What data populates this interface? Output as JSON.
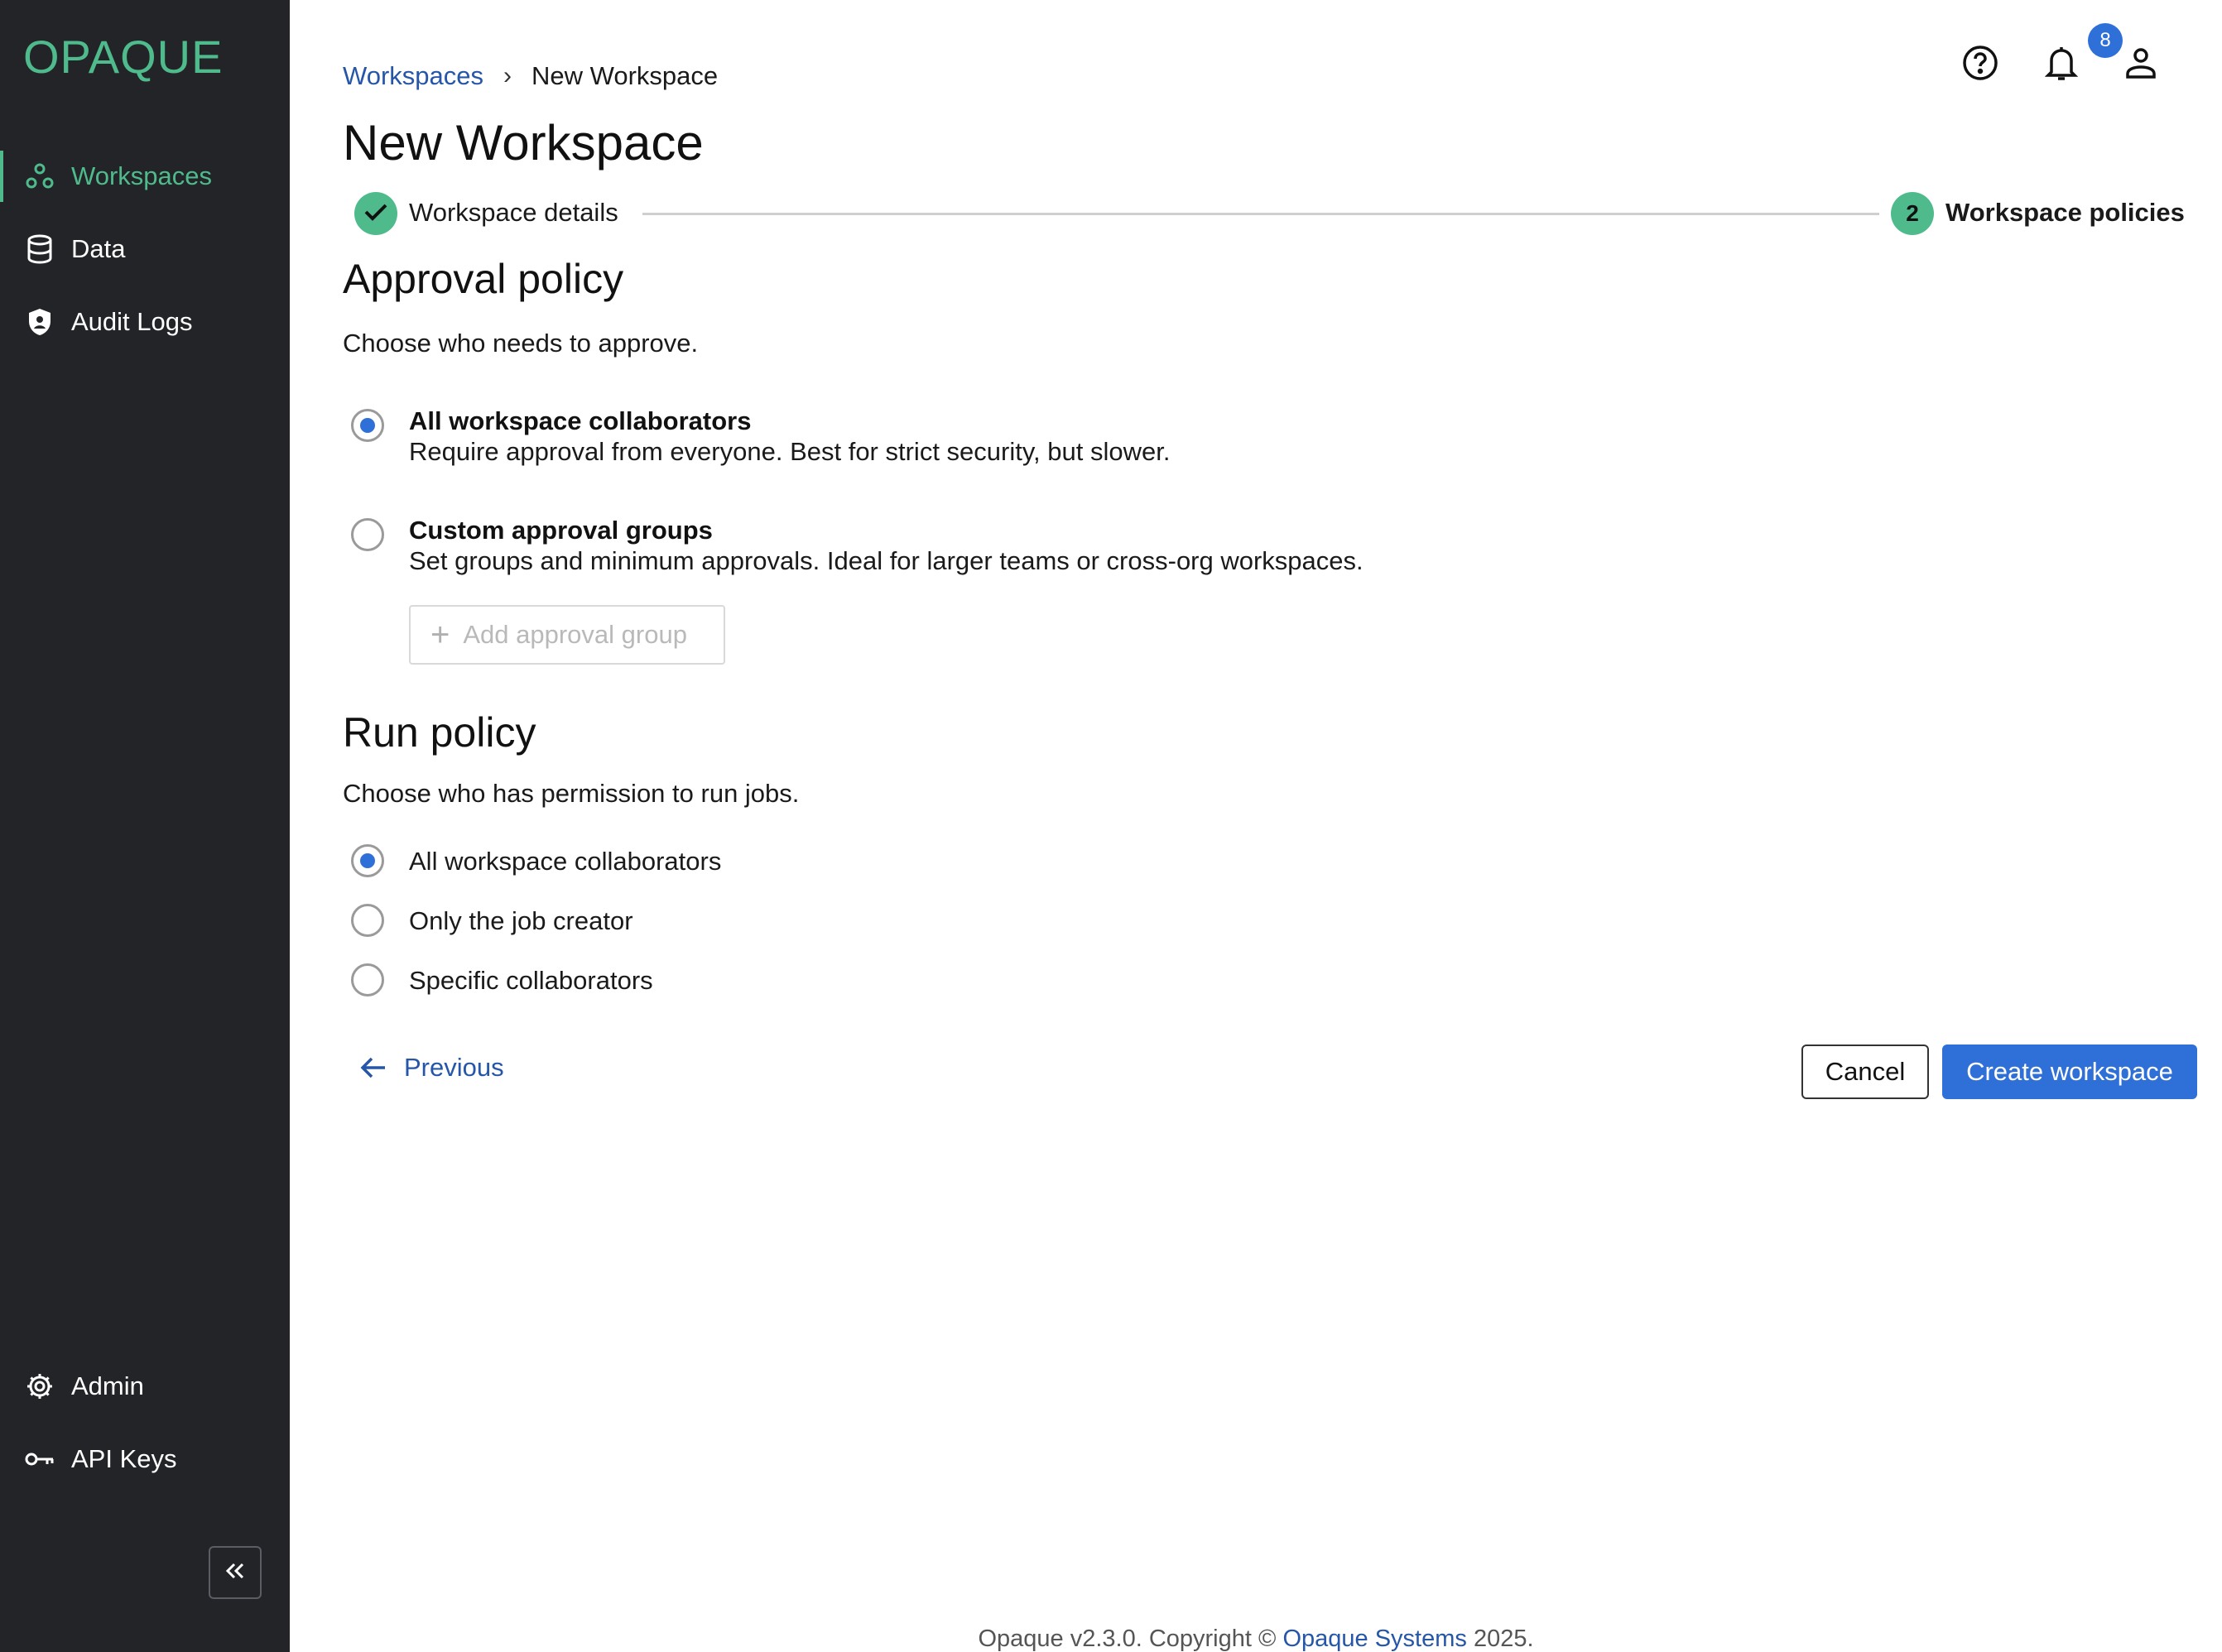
{
  "app": {
    "logo": "OPAQUE"
  },
  "colors": {
    "brand_green": "#4fbb8c",
    "primary_blue": "#2f6fd8",
    "link_blue": "#2556a8",
    "sidebar_bg": "#222428"
  },
  "sidebar": {
    "items": [
      {
        "label": "Workspaces",
        "icon": "workspaces-icon",
        "active": true
      },
      {
        "label": "Data",
        "icon": "database-icon"
      },
      {
        "label": "Audit Logs",
        "icon": "shield-icon"
      }
    ],
    "bottom_items": [
      {
        "label": "Admin",
        "icon": "gear-icon"
      },
      {
        "label": "API Keys",
        "icon": "key-icon"
      }
    ],
    "collapse_icon": "double-chevron-left-icon"
  },
  "header": {
    "notification_count": "8",
    "icons": [
      "help-icon",
      "bell-icon",
      "user-icon"
    ]
  },
  "breadcrumb": {
    "parent": "Workspaces",
    "separator": "›",
    "current": "New Workspace"
  },
  "page_title": "New Workspace",
  "stepper": {
    "step1": {
      "label": "Workspace details",
      "status": "complete"
    },
    "step2": {
      "number": "2",
      "label": "Workspace policies",
      "status": "active"
    }
  },
  "approval_policy": {
    "title": "Approval policy",
    "subtitle": "Choose who needs to approve.",
    "options": [
      {
        "title": "All workspace collaborators",
        "description": "Require approval from everyone. Best for strict security, but slower.",
        "selected": true
      },
      {
        "title": "Custom approval groups",
        "description": "Set groups and minimum approvals. Ideal for larger teams or cross-org workspaces.",
        "selected": false
      }
    ],
    "add_group_label": "Add approval group"
  },
  "run_policy": {
    "title": "Run policy",
    "subtitle": "Choose who has permission to run jobs.",
    "options": [
      {
        "label": "All workspace collaborators",
        "selected": true
      },
      {
        "label": "Only the job creator",
        "selected": false
      },
      {
        "label": "Specific collaborators",
        "selected": false
      }
    ]
  },
  "actions": {
    "previous": "Previous",
    "cancel": "Cancel",
    "create": "Create workspace"
  },
  "footer": {
    "prefix": "Opaque v2.3.0. Copyright ©",
    "link": "Opaque Systems",
    "suffix": "2025."
  }
}
